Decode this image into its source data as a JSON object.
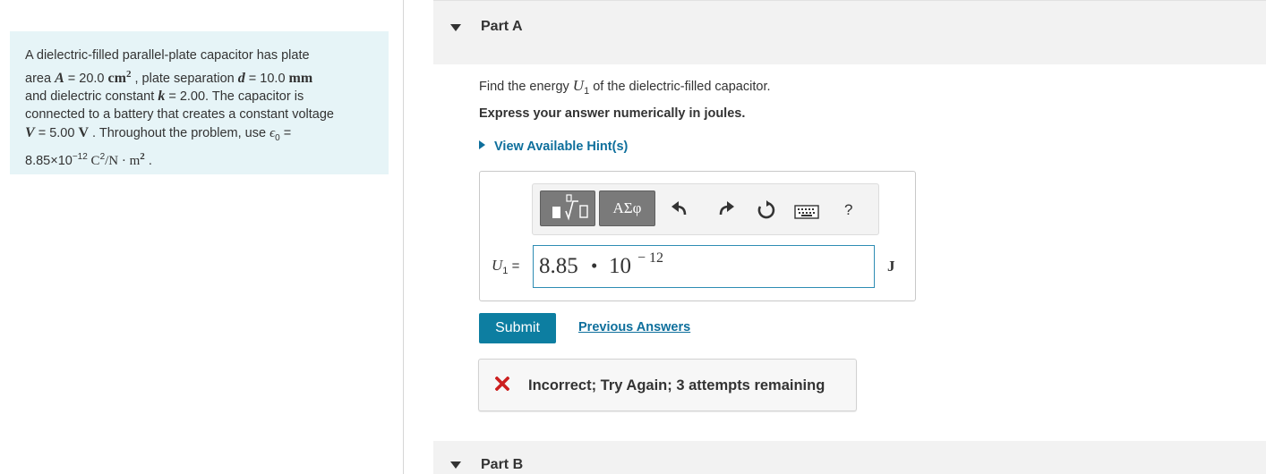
{
  "problem": {
    "t1": "A dielectric-filled parallel-plate capacitor has plate",
    "t2": "area ",
    "A_sym": "A",
    "t3": " = 20.0 ",
    "cm": "cm",
    "sq": "2",
    "t4": " , plate separation ",
    "d_sym": "d",
    "t5": " = 10.0 ",
    "mm": "mm",
    "t6": "and dielectric constant ",
    "k_sym": "k",
    "t7": " = 2.00. The capacitor is",
    "t8": "connected to a battery that creates a constant voltage",
    "V_sym": "V",
    "t9": " = 5.00 ",
    "V_unit": "V",
    "t10": " . Throughout the problem, use ",
    "eps": "ϵ",
    "eps_sub": "0",
    "t11": " =",
    "t12": "8.85×10",
    "exp": "−12",
    "t13": " C",
    "c_exp": "2",
    "t14": "/N · m",
    "m_exp": "2",
    "t15": " ."
  },
  "partA": {
    "title": "Part A",
    "q_pre": "Find the energy ",
    "q_var": "U",
    "q_sub": "1",
    "q_post": " of the dielectric-filled capacitor.",
    "instruction": "Express your answer numerically in joules.",
    "hint": "View Available Hint(s)"
  },
  "toolbar": {
    "greek": "ΑΣφ",
    "help": "?"
  },
  "answer": {
    "label_var": "U",
    "label_sub": "1",
    "label_eq": " =",
    "mantissa": "8.85",
    "dot": "•",
    "base": "10",
    "exponent": "− 12",
    "unit": "J"
  },
  "actions": {
    "submit": "Submit",
    "previous": "Previous Answers"
  },
  "feedback": {
    "message": "Incorrect; Try Again; 3 attempts remaining"
  },
  "partB": {
    "title": "Part B"
  },
  "colors": {
    "accent": "#0d7ea1",
    "link": "#0e6f9c",
    "error": "#cc1f1f",
    "problem_bg": "#e6f4f7"
  }
}
